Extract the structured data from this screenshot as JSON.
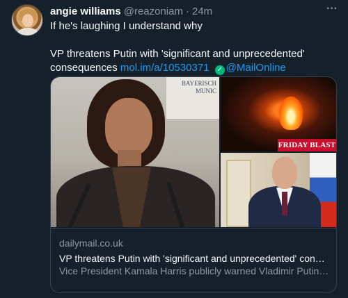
{
  "tweet": {
    "author_name": "angie williams",
    "author_handle": "@reazoniam",
    "separator": "·",
    "time": "24m",
    "more_label": "···",
    "text_line1": "If he's laughing I understand why",
    "text_headline": "VP threatens Putin with 'significant and unprecedented' consequences",
    "text_link": "mol.im/a/10530371",
    "text_mention": "@MailOnline",
    "verified_icon": "✓"
  },
  "card": {
    "logo_text": "BAYERISCH\nMUNIC",
    "friday_badge": "FRIDAY BLAST",
    "domain": "dailymail.co.uk",
    "title": "VP threatens Putin with 'significant and unprecedented' consequences",
    "description": "Vice President Kamala Harris publicly warned Vladimir Putin of the 'swift and severe' consequences he will face if Russia invades Ukraine"
  },
  "icons": {
    "avatar": "profile-avatar",
    "more": "more-options-icon",
    "verified": "verified-badge-icon"
  },
  "colors": {
    "background": "#15202b",
    "link": "#1d9bf0",
    "muted": "#8b98a5",
    "verified": "#00ba7c",
    "badge": "#c8102e"
  }
}
